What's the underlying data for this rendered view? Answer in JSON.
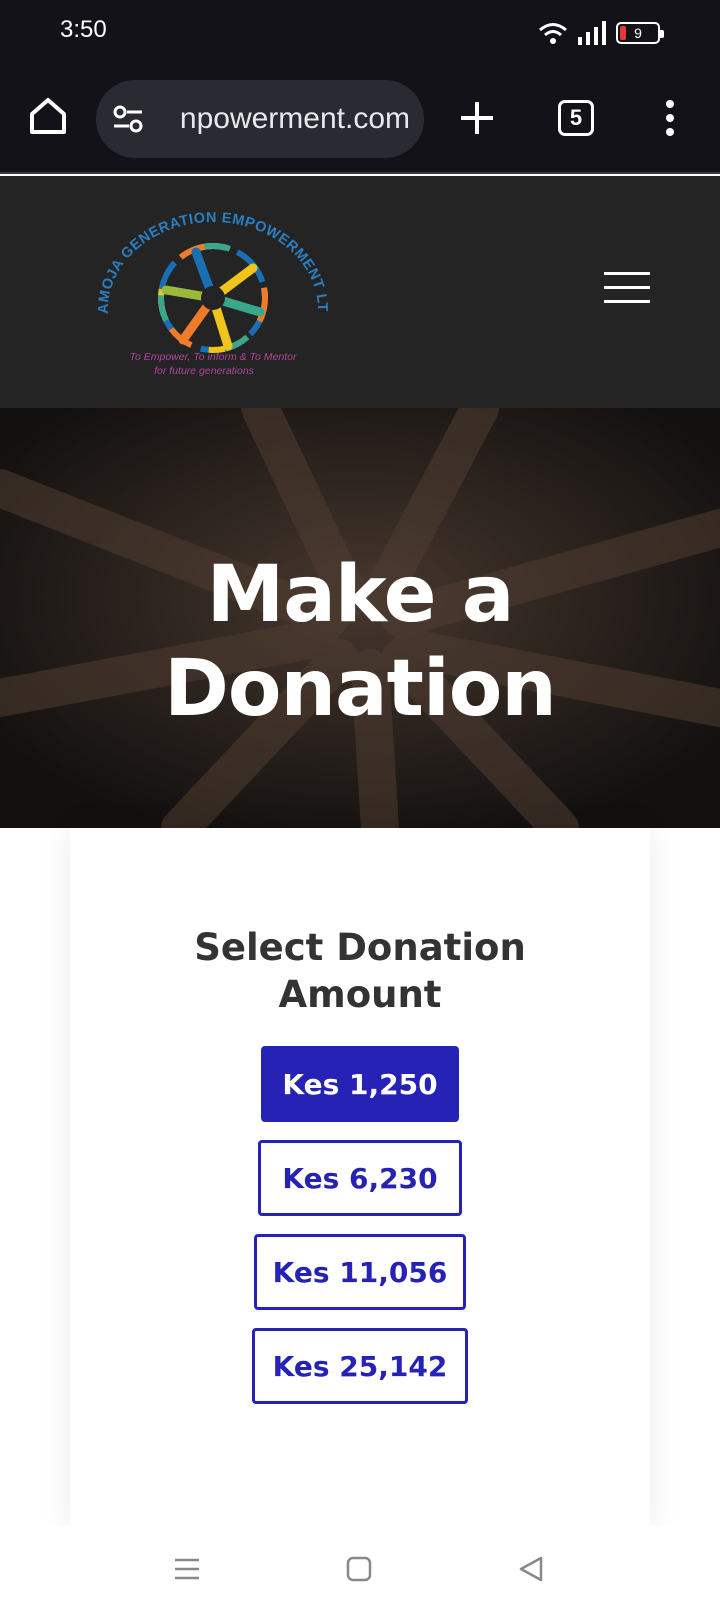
{
  "status_bar": {
    "time": "3:50",
    "battery_level": "9",
    "icons": [
      "wifi-icon",
      "signal-icon",
      "battery-icon"
    ]
  },
  "browser": {
    "url": "npowerment.com",
    "tab_count": "5",
    "icons": [
      "home-icon",
      "site-settings-icon",
      "new-tab-icon",
      "tabs-icon",
      "more-menu-icon"
    ]
  },
  "site": {
    "logo": {
      "ring_text": "PAMOJA GENERATION EMPOWERMENT LTD",
      "tagline_line1": "To Empower, To inform & To Mentor",
      "tagline_line2": "for future generations"
    },
    "menu_icon": "hamburger-icon"
  },
  "hero": {
    "title_line1": "Make a",
    "title_line2": "Donation"
  },
  "donation": {
    "title_line1": "Select Donation",
    "title_line2": "Amount",
    "amounts": [
      {
        "label": "Kes 1,250",
        "selected": true
      },
      {
        "label": "Kes 6,230",
        "selected": false
      },
      {
        "label": "Kes 11,056",
        "selected": false
      },
      {
        "label": "Kes 25,142",
        "selected": false
      }
    ]
  },
  "colors": {
    "accent": "#2622b5",
    "header_bg": "#242424",
    "status_bg": "#131219"
  },
  "nav_bar": {
    "icons": [
      "recents-icon",
      "home-square-icon",
      "back-icon"
    ]
  }
}
